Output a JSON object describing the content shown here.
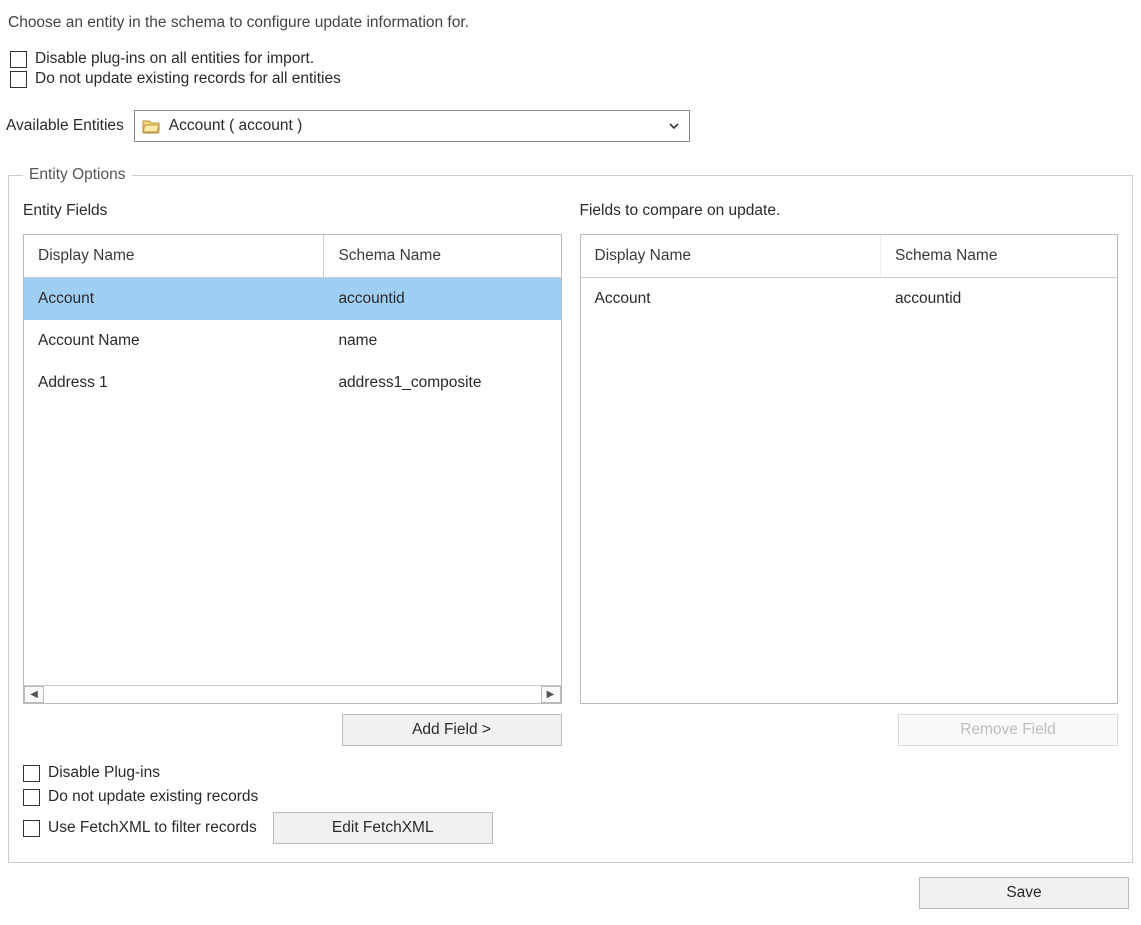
{
  "instruction": "Choose an entity in the schema to configure update information for.",
  "topChecks": {
    "disablePlugins": "Disable plug-ins on all entities for import.",
    "noUpdateExisting": "Do not update existing records for all entities"
  },
  "available": {
    "label": "Available Entities",
    "selected": "Account  ( account )"
  },
  "entityOptions": {
    "legend": "Entity Options",
    "left": {
      "title": "Entity Fields",
      "headers": {
        "c1": "Display Name",
        "c2": "Schema Name"
      },
      "rows": [
        {
          "display": "Account",
          "schema": "accountid",
          "selected": true
        },
        {
          "display": "Account Name",
          "schema": "name",
          "selected": false
        },
        {
          "display": "Address 1",
          "schema": "address1_composite",
          "selected": false
        }
      ],
      "button": "Add Field >"
    },
    "right": {
      "title": "Fields to compare on update.",
      "headers": {
        "c1": "Display Name",
        "c2": "Schema Name"
      },
      "rows": [
        {
          "display": "Account",
          "schema": "accountid",
          "selected": false
        }
      ],
      "button": "Remove Field",
      "buttonDisabled": true
    },
    "lowerChecks": {
      "disablePlugins": "Disable Plug-ins",
      "noUpdateExisting": "Do not update existing records",
      "useFetchXml": "Use FetchXML to filter records",
      "editFetchXml": "Edit FetchXML"
    }
  },
  "footer": {
    "save": "Save"
  }
}
